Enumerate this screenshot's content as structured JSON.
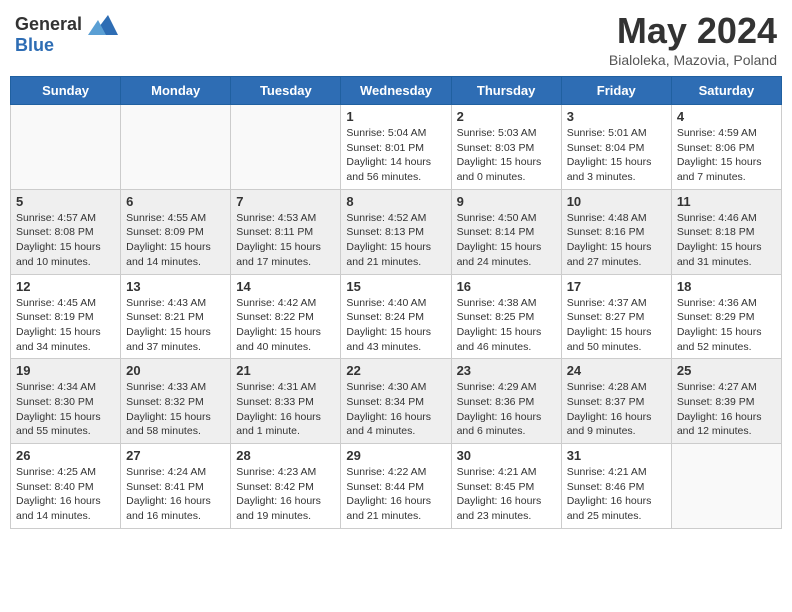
{
  "header": {
    "logo_general": "General",
    "logo_blue": "Blue",
    "month_title": "May 2024",
    "subtitle": "Bialoleka, Mazovia, Poland"
  },
  "weekdays": [
    "Sunday",
    "Monday",
    "Tuesday",
    "Wednesday",
    "Thursday",
    "Friday",
    "Saturday"
  ],
  "weeks": [
    [
      {
        "day": "",
        "info": ""
      },
      {
        "day": "",
        "info": ""
      },
      {
        "day": "",
        "info": ""
      },
      {
        "day": "1",
        "info": "Sunrise: 5:04 AM\nSunset: 8:01 PM\nDaylight: 14 hours\nand 56 minutes."
      },
      {
        "day": "2",
        "info": "Sunrise: 5:03 AM\nSunset: 8:03 PM\nDaylight: 15 hours\nand 0 minutes."
      },
      {
        "day": "3",
        "info": "Sunrise: 5:01 AM\nSunset: 8:04 PM\nDaylight: 15 hours\nand 3 minutes."
      },
      {
        "day": "4",
        "info": "Sunrise: 4:59 AM\nSunset: 8:06 PM\nDaylight: 15 hours\nand 7 minutes."
      }
    ],
    [
      {
        "day": "5",
        "info": "Sunrise: 4:57 AM\nSunset: 8:08 PM\nDaylight: 15 hours\nand 10 minutes."
      },
      {
        "day": "6",
        "info": "Sunrise: 4:55 AM\nSunset: 8:09 PM\nDaylight: 15 hours\nand 14 minutes."
      },
      {
        "day": "7",
        "info": "Sunrise: 4:53 AM\nSunset: 8:11 PM\nDaylight: 15 hours\nand 17 minutes."
      },
      {
        "day": "8",
        "info": "Sunrise: 4:52 AM\nSunset: 8:13 PM\nDaylight: 15 hours\nand 21 minutes."
      },
      {
        "day": "9",
        "info": "Sunrise: 4:50 AM\nSunset: 8:14 PM\nDaylight: 15 hours\nand 24 minutes."
      },
      {
        "day": "10",
        "info": "Sunrise: 4:48 AM\nSunset: 8:16 PM\nDaylight: 15 hours\nand 27 minutes."
      },
      {
        "day": "11",
        "info": "Sunrise: 4:46 AM\nSunset: 8:18 PM\nDaylight: 15 hours\nand 31 minutes."
      }
    ],
    [
      {
        "day": "12",
        "info": "Sunrise: 4:45 AM\nSunset: 8:19 PM\nDaylight: 15 hours\nand 34 minutes."
      },
      {
        "day": "13",
        "info": "Sunrise: 4:43 AM\nSunset: 8:21 PM\nDaylight: 15 hours\nand 37 minutes."
      },
      {
        "day": "14",
        "info": "Sunrise: 4:42 AM\nSunset: 8:22 PM\nDaylight: 15 hours\nand 40 minutes."
      },
      {
        "day": "15",
        "info": "Sunrise: 4:40 AM\nSunset: 8:24 PM\nDaylight: 15 hours\nand 43 minutes."
      },
      {
        "day": "16",
        "info": "Sunrise: 4:38 AM\nSunset: 8:25 PM\nDaylight: 15 hours\nand 46 minutes."
      },
      {
        "day": "17",
        "info": "Sunrise: 4:37 AM\nSunset: 8:27 PM\nDaylight: 15 hours\nand 50 minutes."
      },
      {
        "day": "18",
        "info": "Sunrise: 4:36 AM\nSunset: 8:29 PM\nDaylight: 15 hours\nand 52 minutes."
      }
    ],
    [
      {
        "day": "19",
        "info": "Sunrise: 4:34 AM\nSunset: 8:30 PM\nDaylight: 15 hours\nand 55 minutes."
      },
      {
        "day": "20",
        "info": "Sunrise: 4:33 AM\nSunset: 8:32 PM\nDaylight: 15 hours\nand 58 minutes."
      },
      {
        "day": "21",
        "info": "Sunrise: 4:31 AM\nSunset: 8:33 PM\nDaylight: 16 hours\nand 1 minute."
      },
      {
        "day": "22",
        "info": "Sunrise: 4:30 AM\nSunset: 8:34 PM\nDaylight: 16 hours\nand 4 minutes."
      },
      {
        "day": "23",
        "info": "Sunrise: 4:29 AM\nSunset: 8:36 PM\nDaylight: 16 hours\nand 6 minutes."
      },
      {
        "day": "24",
        "info": "Sunrise: 4:28 AM\nSunset: 8:37 PM\nDaylight: 16 hours\nand 9 minutes."
      },
      {
        "day": "25",
        "info": "Sunrise: 4:27 AM\nSunset: 8:39 PM\nDaylight: 16 hours\nand 12 minutes."
      }
    ],
    [
      {
        "day": "26",
        "info": "Sunrise: 4:25 AM\nSunset: 8:40 PM\nDaylight: 16 hours\nand 14 minutes."
      },
      {
        "day": "27",
        "info": "Sunrise: 4:24 AM\nSunset: 8:41 PM\nDaylight: 16 hours\nand 16 minutes."
      },
      {
        "day": "28",
        "info": "Sunrise: 4:23 AM\nSunset: 8:42 PM\nDaylight: 16 hours\nand 19 minutes."
      },
      {
        "day": "29",
        "info": "Sunrise: 4:22 AM\nSunset: 8:44 PM\nDaylight: 16 hours\nand 21 minutes."
      },
      {
        "day": "30",
        "info": "Sunrise: 4:21 AM\nSunset: 8:45 PM\nDaylight: 16 hours\nand 23 minutes."
      },
      {
        "day": "31",
        "info": "Sunrise: 4:21 AM\nSunset: 8:46 PM\nDaylight: 16 hours\nand 25 minutes."
      },
      {
        "day": "",
        "info": ""
      }
    ]
  ]
}
